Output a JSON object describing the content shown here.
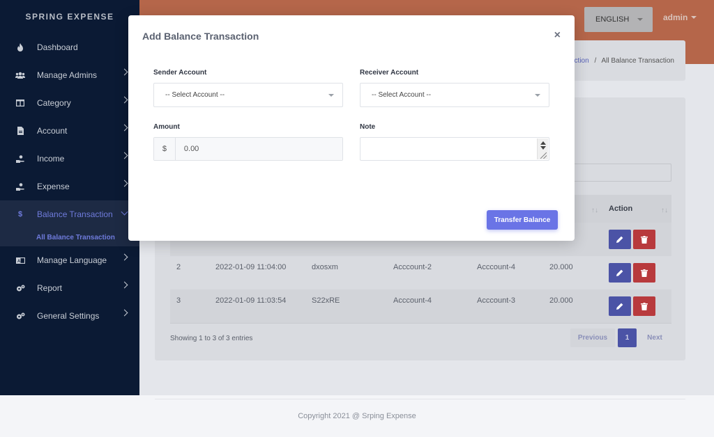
{
  "brand": "SPRING EXPENSE",
  "sidebar": {
    "items": [
      {
        "label": "Dashboard",
        "icon": "fire-icon"
      },
      {
        "label": "Manage Admins",
        "icon": "users-icon"
      },
      {
        "label": "Category",
        "icon": "columns-icon"
      },
      {
        "label": "Account",
        "icon": "file-icon"
      },
      {
        "label": "Income",
        "icon": "hand-money-icon"
      },
      {
        "label": "Expense",
        "icon": "hand-money-icon"
      },
      {
        "label": "Balance Transaction",
        "icon": "dollar-icon",
        "active": true
      },
      {
        "label": "Manage Language",
        "icon": "language-icon"
      },
      {
        "label": "Report",
        "icon": "cogs-icon"
      },
      {
        "label": "General Settings",
        "icon": "cogs-icon"
      }
    ],
    "sub_item": "All Balance Transaction"
  },
  "topbar": {
    "language": "ENGLISH",
    "user": "admin"
  },
  "breadcrumb": {
    "link": "action",
    "separator": "/",
    "current": "All Balance Transaction"
  },
  "table": {
    "action_header": "Action",
    "rows": [
      {
        "no": "2",
        "date": "2022-01-09 11:04:00",
        "trx": "dxosxm",
        "from": "Acccount-2",
        "to": "Acccount-4",
        "amount": "20.000"
      },
      {
        "no": "3",
        "date": "2022-01-09 11:03:54",
        "trx": "S22xRE",
        "from": "Acccount-4",
        "to": "Acccount-3",
        "amount": "20.000"
      }
    ],
    "entries": "Showing 1 to 3 of 3 entries",
    "pager": {
      "prev": "Previous",
      "page": "1",
      "next": "Next"
    }
  },
  "footer": "Copyright 2021 @ Srping Expense",
  "modal": {
    "title": "Add Balance Transaction",
    "close": "×",
    "sender_label": "Sender Account",
    "sender_value": "-- Select Account --",
    "receiver_label": "Receiver Account",
    "receiver_value": "-- Select Account --",
    "amount_label": "Amount",
    "amount_prefix": "$",
    "amount_placeholder": "0.00",
    "note_label": "Note",
    "submit": "Transfer Balance"
  },
  "colors": {
    "sidebar_bg": "#0b1a34",
    "topbar_bg": "#b5664a",
    "accent": "#6a74e6",
    "danger": "#b83a3d"
  }
}
